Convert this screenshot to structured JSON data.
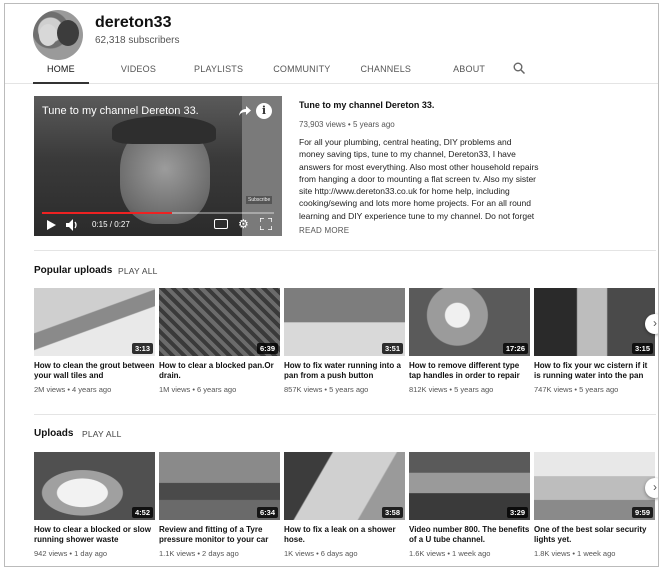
{
  "channel": {
    "name": "dereton33",
    "subscribers": "62,318 subscribers"
  },
  "tabs": [
    {
      "label": "HOME",
      "active": true
    },
    {
      "label": "VIDEOS",
      "active": false
    },
    {
      "label": "PLAYLISTS",
      "active": false
    },
    {
      "label": "COMMUNITY",
      "active": false
    },
    {
      "label": "CHANNELS",
      "active": false
    },
    {
      "label": "ABOUT",
      "active": false
    }
  ],
  "player": {
    "overlay_title": "Tune to my channel Dereton 33.",
    "time": "0:15 / 0:27",
    "progress": 0.56,
    "badge": "Subscribe"
  },
  "featured": {
    "title": "Tune to my channel Dereton 33.",
    "meta": "73,903 views • 5 years ago",
    "description": "For all your plumbing, central heating,  DIY problems and money saving tips, tune to my channel, Dereton33, I have answers for most everything. Also most other household repairs from hanging a door to mounting a flat screen tv. Also my sister site http://www.dereton33.co.uk for home help, including cooking/sewing and lots more home projects. For an all round learning and DIY experience tune to my channel. Do not forget to",
    "read_more": "READ MORE"
  },
  "popular": {
    "title": "Popular uploads",
    "play_all": "PLAY ALL",
    "videos": [
      {
        "title": "How to clean the grout between your wall tiles and",
        "meta": "2M views • 4 years ago",
        "duration": "3:13"
      },
      {
        "title": "How to clear a blocked pan.Or drain.",
        "meta": "1M views • 6 years ago",
        "duration": "6:39"
      },
      {
        "title": "How to fix water running into a pan from a push button",
        "meta": "857K views • 5 years ago",
        "duration": "3:51"
      },
      {
        "title": "How to remove different type tap handles in order to repair",
        "meta": "812K views • 5 years ago",
        "duration": "17:26"
      },
      {
        "title": "How to fix your wc cistern if it is running water into the pan",
        "meta": "747K views • 5 years ago",
        "duration": "3:15"
      }
    ]
  },
  "uploads": {
    "title": "Uploads",
    "play_all": "PLAY ALL",
    "videos": [
      {
        "title": "How to clear a blocked or slow running shower waste",
        "meta": "942 views • 1 day ago",
        "duration": "4:52"
      },
      {
        "title": "Review and fitting of a Tyre pressure monitor to your car",
        "meta": "1.1K views • 2 days ago",
        "duration": "6:34"
      },
      {
        "title": "How to fix a leak on a shower hose.",
        "meta": "1K views • 6 days ago",
        "duration": "3:58"
      },
      {
        "title": "Video number 800. The benefits of a U tube channel.",
        "meta": "1.6K views • 1 week ago",
        "duration": "3:29"
      },
      {
        "title": "One of the best solar security lights yet.",
        "meta": "1.8K views • 1 week ago",
        "duration": "9:59"
      }
    ]
  },
  "icons": {
    "search": "search-icon",
    "next": "chevron-right-icon"
  }
}
